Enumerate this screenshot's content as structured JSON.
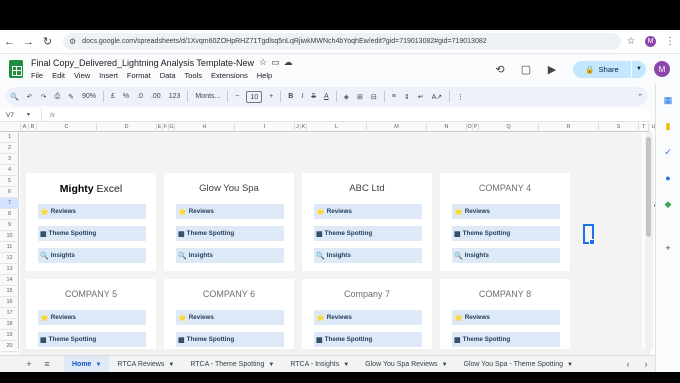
{
  "browser": {
    "url": "docs.google.com/spreadsheets/d/1Xvqm60ZOHpRHZ71Tgdlsq5nLqRjiwkMWNch4bYoqhEw/edit?gid=719013082#gid=719013082",
    "account_initial": "M"
  },
  "doc": {
    "title": "Final Copy_Delivered_Lightning Analysis Template-New",
    "menus": [
      "File",
      "Edit",
      "View",
      "Insert",
      "Format",
      "Data",
      "Tools",
      "Extensions",
      "Help"
    ],
    "share_label": "Share",
    "avatar": "M"
  },
  "toolbar": {
    "zoom": "90%",
    "currency": "£",
    "percent": "%",
    "dec_dec": ".0",
    "dec_inc": ".00",
    "format123": "123",
    "font": "Monts...",
    "font_size": "10"
  },
  "formula": {
    "cell_ref": "V7",
    "fx": "fx"
  },
  "columns": [
    "A",
    "B",
    "C",
    "D",
    "E",
    "F",
    "G",
    "H",
    "I",
    "J",
    "K",
    "L",
    "M",
    "N",
    "O",
    "P",
    "Q",
    "R",
    "S",
    "T",
    "U",
    "V"
  ],
  "rows": [
    "1",
    "2",
    "3",
    "4",
    "5",
    "6",
    "7",
    "8",
    "9",
    "10",
    "11",
    "12",
    "13",
    "14",
    "15",
    "16",
    "17",
    "18",
    "19",
    "20"
  ],
  "buttons": {
    "reviews": "Reviews",
    "theme": "Theme Spotting",
    "insights": "Insights"
  },
  "cards": [
    {
      "name_a": "Mighty",
      "name_b": "Excel",
      "style": "bold"
    },
    {
      "name_a": "Glow You Spa",
      "name_b": "",
      "style": "normal"
    },
    {
      "name_a": "ABC Ltd",
      "name_b": "",
      "style": "normal"
    },
    {
      "name_a": "COMPANY 4",
      "name_b": "",
      "style": "muted"
    },
    {
      "name_a": "COMPANY 5",
      "name_b": "",
      "style": "muted"
    },
    {
      "name_a": "COMPANY 6",
      "name_b": "",
      "style": "muted"
    },
    {
      "name_a": "Company 7",
      "name_b": "",
      "style": "muted"
    },
    {
      "name_a": "COMPANY 8",
      "name_b": "",
      "style": "muted"
    }
  ],
  "tabs": [
    {
      "label": "Home",
      "active": true
    },
    {
      "label": "RTCA Reviews",
      "active": false
    },
    {
      "label": "RTCA - Theme Spotting",
      "active": false
    },
    {
      "label": "RTCA - Insights",
      "active": false
    },
    {
      "label": "Glow You Spa Reviews",
      "active": false
    },
    {
      "label": "Glow You Spa - Theme Spotting",
      "active": false
    }
  ],
  "colors": {
    "accent": "#1a73e8",
    "share_bg": "#c2e7ff",
    "button_bg": "#dde9f6",
    "sheets_green": "#1e8e3e"
  }
}
